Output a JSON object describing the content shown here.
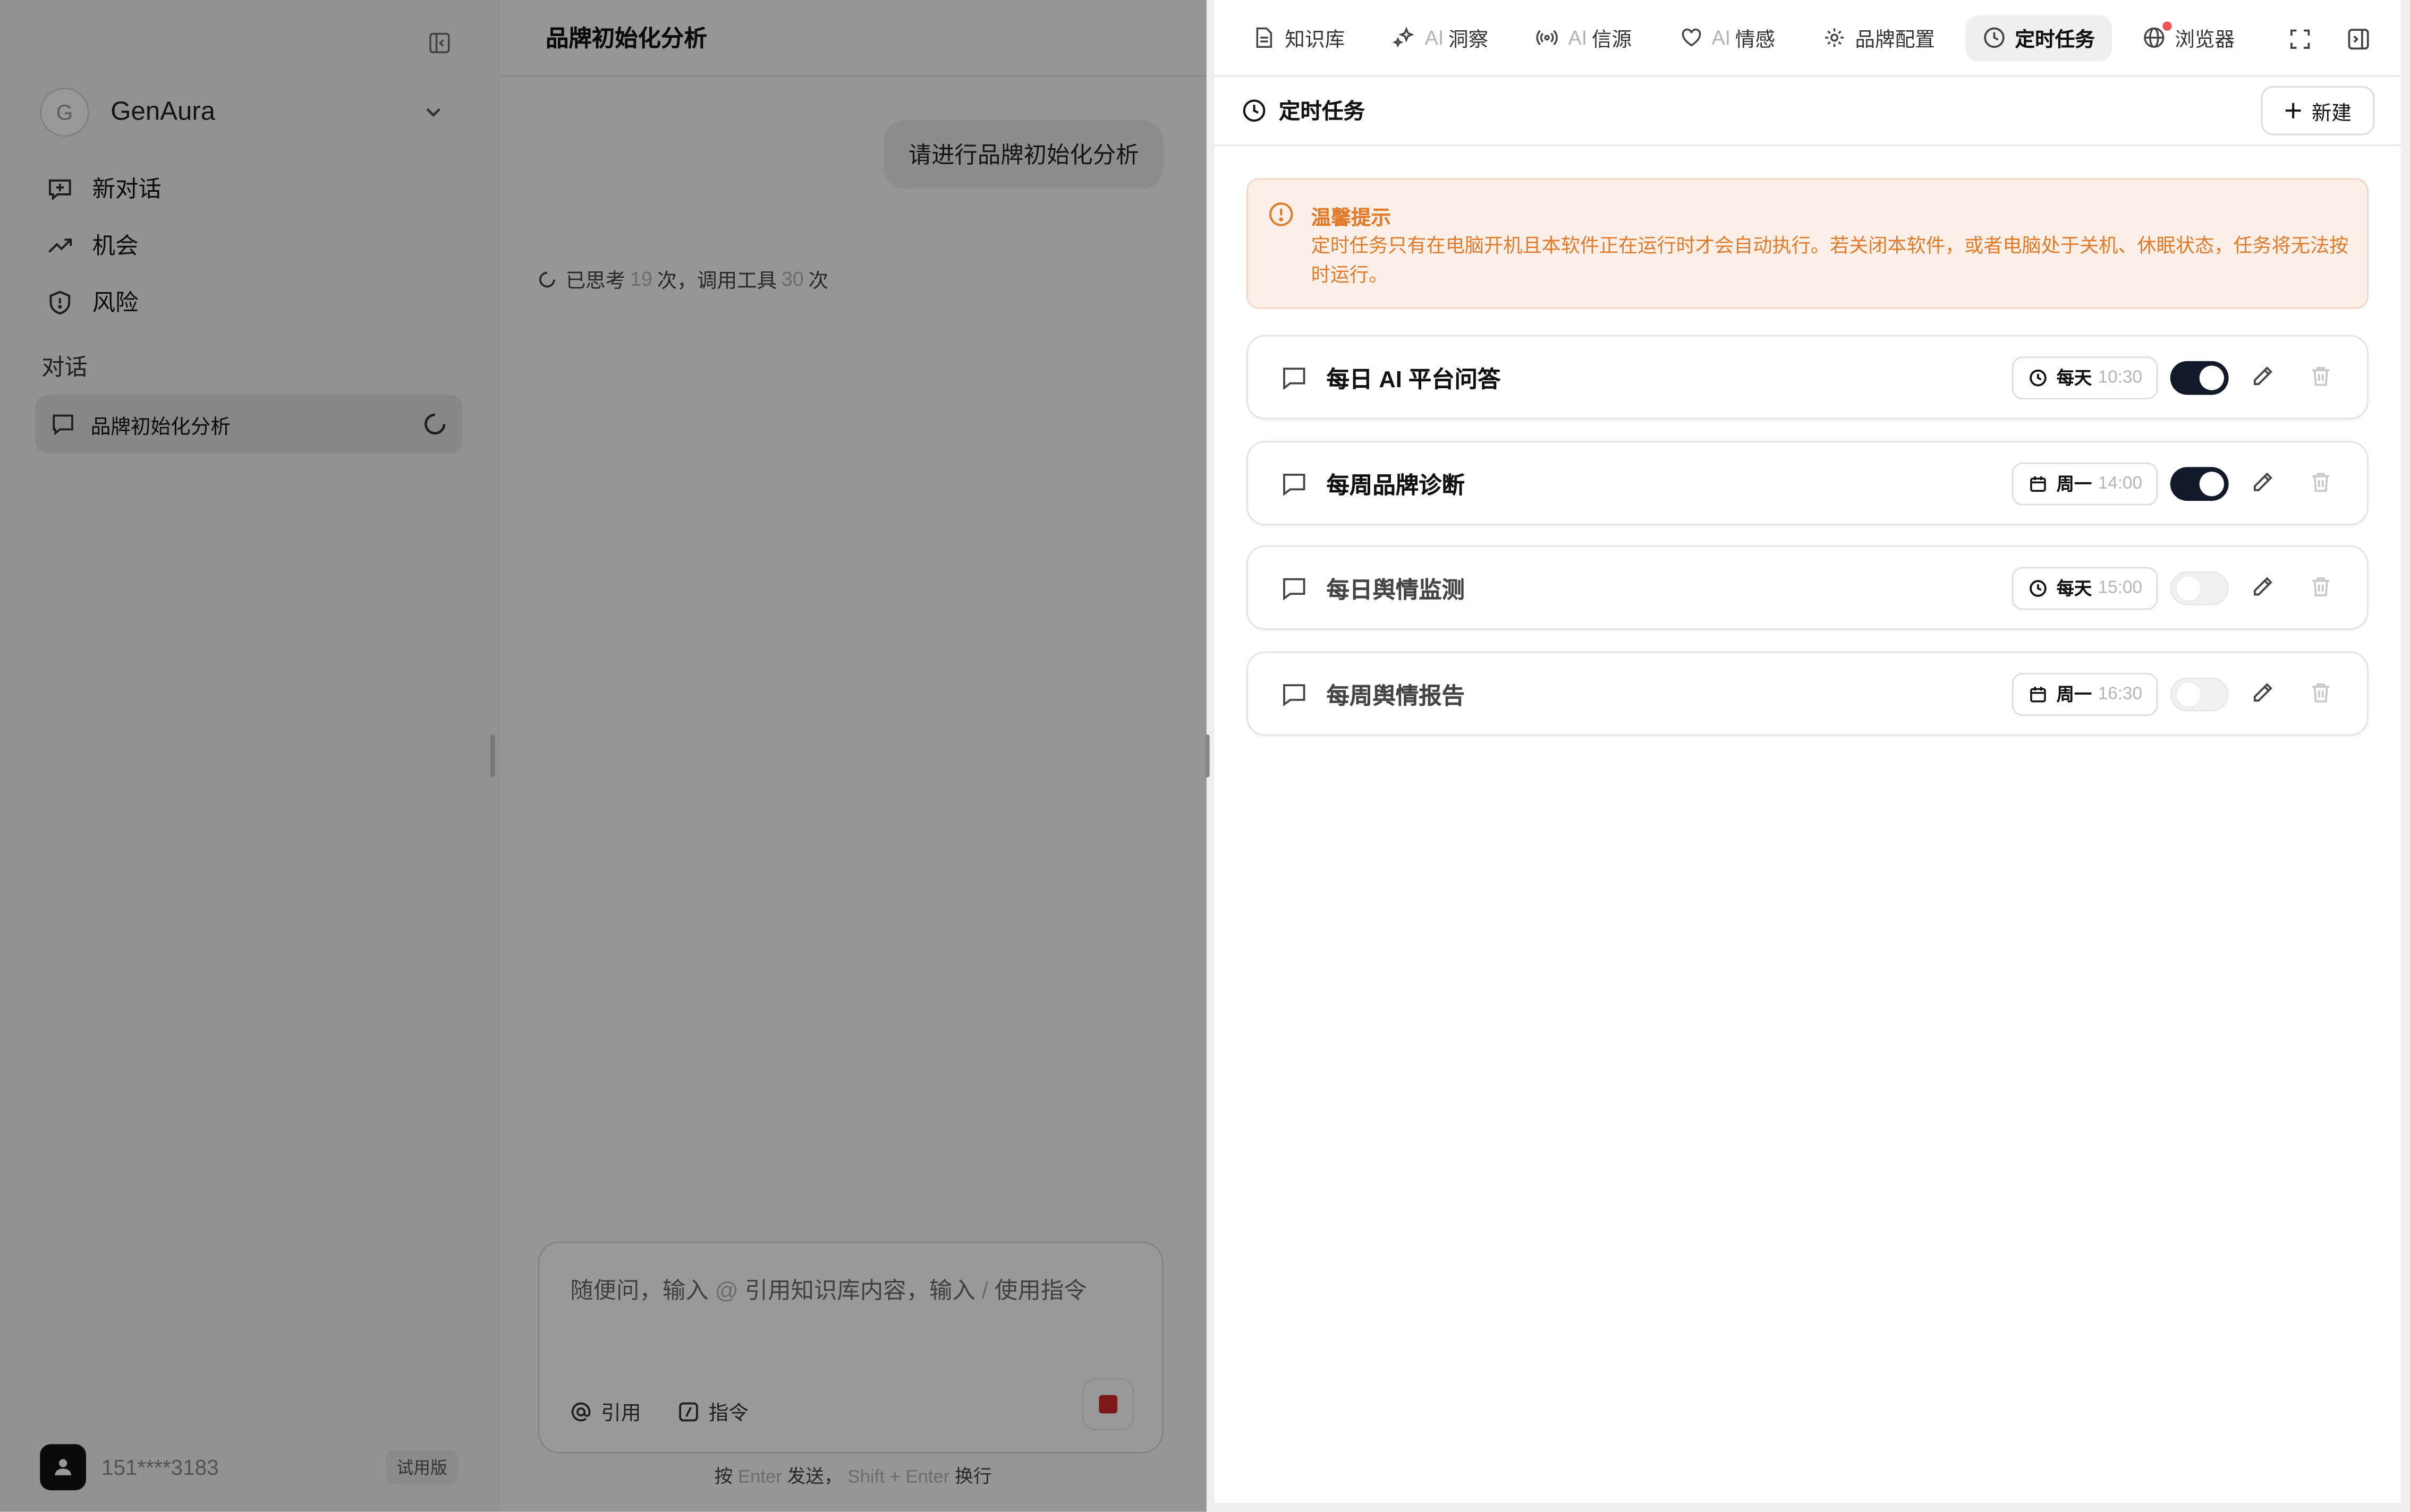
{
  "sidebar": {
    "org_initial": "G",
    "org_name": "GenAura",
    "nav": [
      {
        "label": "新对话",
        "icon": "new-chat-icon"
      },
      {
        "label": "机会",
        "icon": "trending-up-icon"
      },
      {
        "label": "风险",
        "icon": "shield-icon"
      }
    ],
    "section_label": "对话",
    "conversation": {
      "label": "品牌初始化分析",
      "status_icon": "loading-spinner-icon"
    },
    "user": {
      "phone": "151****3183",
      "badge": "试用版"
    }
  },
  "chat": {
    "title": "品牌初始化分析",
    "user_message": "请进行品牌初始化分析",
    "thinking": {
      "prefix": "已思考",
      "think_count": "19",
      "mid": "次，调用工具",
      "tool_count": "30",
      "suffix": "次"
    },
    "composer": {
      "placeholder_a": "随便问，输入",
      "at": "@",
      "placeholder_b": "引用知识库内容，输入",
      "slash": "/",
      "placeholder_c": "使用指令",
      "cite_label": "引用",
      "command_label": "指令"
    },
    "hint": {
      "a": "按",
      "enter": "Enter",
      "b": "发送，",
      "shift": "Shift + Enter",
      "c": "换行"
    }
  },
  "right": {
    "tabs": [
      {
        "label": "知识库",
        "ai": "",
        "icon": "document-icon"
      },
      {
        "label": "洞察",
        "ai": "AI",
        "icon": "sparkles-icon"
      },
      {
        "label": "信源",
        "ai": "AI",
        "icon": "broadcast-icon"
      },
      {
        "label": "情感",
        "ai": "AI",
        "icon": "heart-icon"
      },
      {
        "label": "品牌配置",
        "ai": "",
        "icon": "gear-icon"
      },
      {
        "label": "定时任务",
        "ai": "",
        "icon": "clock-icon",
        "active": true
      },
      {
        "label": "浏览器",
        "ai": "",
        "icon": "globe-icon"
      }
    ],
    "panel_title": "定时任务",
    "new_button": "新建",
    "warning": {
      "title": "温馨提示",
      "text": "定时任务只有在电脑开机且本软件正在运行时才会自动执行。若关闭本软件，或者电脑处于关机、休眠状态，任务将无法按时运行。"
    },
    "tasks": [
      {
        "name": "每日 AI 平台问答",
        "freq": "每天",
        "time": "10:30",
        "enabled": true,
        "sched_icon": "clock-icon"
      },
      {
        "name": "每周品牌诊断",
        "freq": "周一",
        "time": "14:00",
        "enabled": true,
        "sched_icon": "calendar-icon"
      },
      {
        "name": "每日舆情监测",
        "freq": "每天",
        "time": "15:00",
        "enabled": false,
        "sched_icon": "clock-icon"
      },
      {
        "name": "每周舆情报告",
        "freq": "周一",
        "time": "16:30",
        "enabled": false,
        "sched_icon": "calendar-icon"
      }
    ]
  }
}
